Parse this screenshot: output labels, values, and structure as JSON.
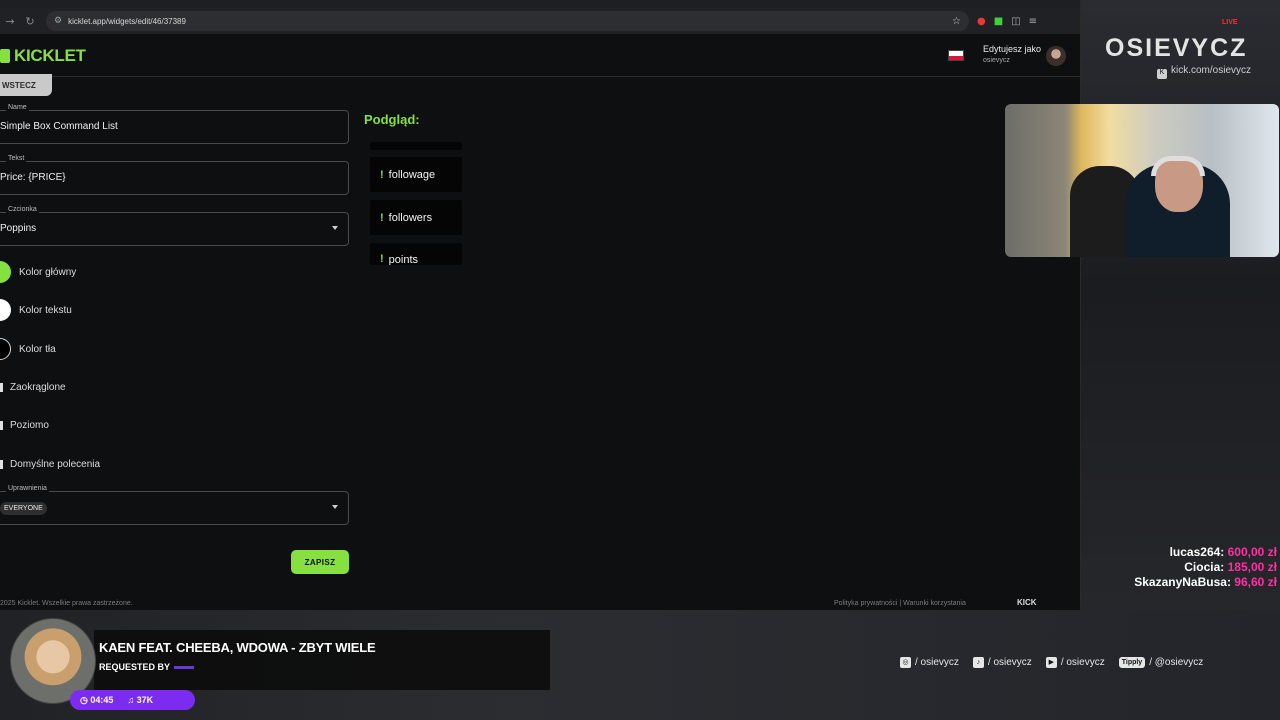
{
  "browser": {
    "url": "kicklet.app/widgets/edit/46/37389",
    "nav": {
      "back": "→",
      "reload": "↻"
    },
    "icons": [
      "star-icon",
      "extension-icon",
      "menu-icon"
    ]
  },
  "app": {
    "logo": "KICKLET",
    "editing_label": "Edytujesz jako",
    "editing_user": "osievycz"
  },
  "form": {
    "back_label": "WSTECZ",
    "name_label": "Name",
    "name_value": "Simple Box Command List",
    "text_label": "Tekst",
    "text_value": "Price: {PRICE}",
    "font_label": "Czcionka",
    "font_value": "Poppins",
    "colors": [
      {
        "label": "Kolor główny",
        "color": "#85e040"
      },
      {
        "label": "Kolor tekstu",
        "color": "#ffffff"
      },
      {
        "label": "Kolor tła",
        "color": "#000000"
      }
    ],
    "checkboxes": [
      {
        "label": "Zaokrąglone"
      },
      {
        "label": "Poziomo"
      },
      {
        "label": "Domyślne polecenia"
      }
    ],
    "perms_label": "Uprawnienia",
    "perms_value": "EVERYONE",
    "save_label": "ZAPISZ"
  },
  "preview": {
    "title": "Podgląd:",
    "items": [
      "followage",
      "followers",
      "points"
    ]
  },
  "footer": {
    "copyright": "2025 Kicklet. Wszelkie prawa zastrzeżone.",
    "links": "Polityka prywatności    |    Warunki korzystania",
    "social": "KICK"
  },
  "stream": {
    "brand": "OSIEVYCZ",
    "live": "LIVE",
    "kick_link": "kick.com/osievycz",
    "donations": [
      {
        "name": "lucas264:",
        "amount": "600,00 zł"
      },
      {
        "name": "Ciocia:",
        "amount": "185,00 zł"
      },
      {
        "name": "SkazanyNaBusa:",
        "amount": "96,60 zł"
      }
    ],
    "now_playing": {
      "title": "KAEN FEAT. CHEEBA, WDOWA - ZBYT WIELE",
      "requested_by": "REQUESTED BY",
      "time": "04:45",
      "plays": "37K"
    },
    "socials": [
      {
        "icon": "instagram-icon",
        "handle": "/ osievycz"
      },
      {
        "icon": "tiktok-icon",
        "handle": "/ osievycz"
      },
      {
        "icon": "youtube-icon",
        "handle": "/ osievycz"
      },
      {
        "icon": "tipply-icon",
        "label": "Tipply",
        "handle": "/ @osievycz"
      }
    ]
  }
}
